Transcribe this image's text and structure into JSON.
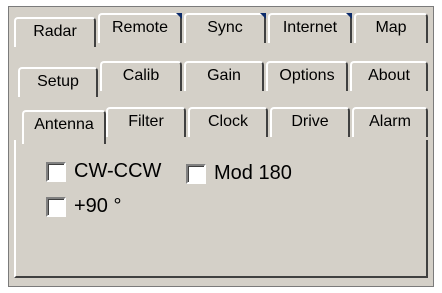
{
  "tabs_row1": [
    "Radar",
    "Remote",
    "Sync",
    "Internet",
    "Map"
  ],
  "tabs_row2": [
    "Setup",
    "Calib",
    "Gain",
    "Options",
    "About"
  ],
  "tabs_row3": [
    "Antenna",
    "Filter",
    "Clock",
    "Drive",
    "Alarm"
  ],
  "active_tab": "Antenna",
  "options": {
    "cw_ccw": {
      "label": "CW-CCW",
      "checked": false
    },
    "mod180": {
      "label": "Mod 180",
      "checked": false
    },
    "plus90": {
      "label": "+90 °",
      "checked": false
    }
  },
  "colors": {
    "face": "#d4d0c8",
    "corner_accent": "#0a2a6b"
  }
}
